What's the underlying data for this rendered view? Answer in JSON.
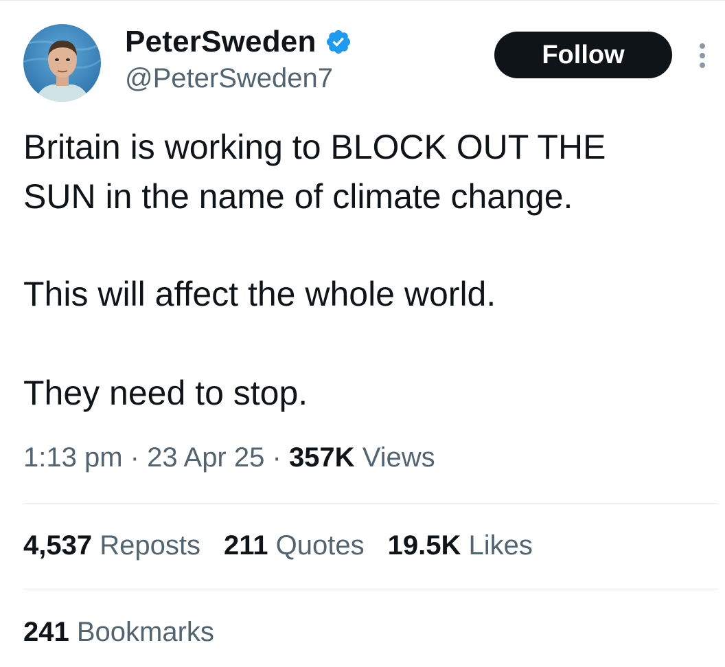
{
  "author": {
    "display_name": "PeterSweden",
    "handle": "@PeterSweden7",
    "verified": true
  },
  "follow_button": {
    "label": "Follow"
  },
  "tweet": {
    "paragraphs": [
      "Britain is working to BLOCK OUT THE",
      "SUN in the name of climate change.",
      "This will affect the whole world.",
      "They need to stop."
    ],
    "time": "1:13 pm",
    "date": "23 Apr 25",
    "views_count": "357K",
    "views_label": "Views",
    "separator": "·"
  },
  "stats": {
    "reposts": {
      "count": "4,537",
      "label": "Reposts"
    },
    "quotes": {
      "count": "211",
      "label": "Quotes"
    },
    "likes": {
      "count": "19.5K",
      "label": "Likes"
    },
    "bookmarks": {
      "count": "241",
      "label": "Bookmarks"
    }
  },
  "icons": {
    "verified": "verified-badge-icon",
    "more": "more-options-icon"
  },
  "colors": {
    "primary_text": "#0f1419",
    "secondary_text": "#536471",
    "verified_blue": "#1d9bf0",
    "follow_bg": "#0f1419",
    "divider": "#e1e6ea"
  }
}
